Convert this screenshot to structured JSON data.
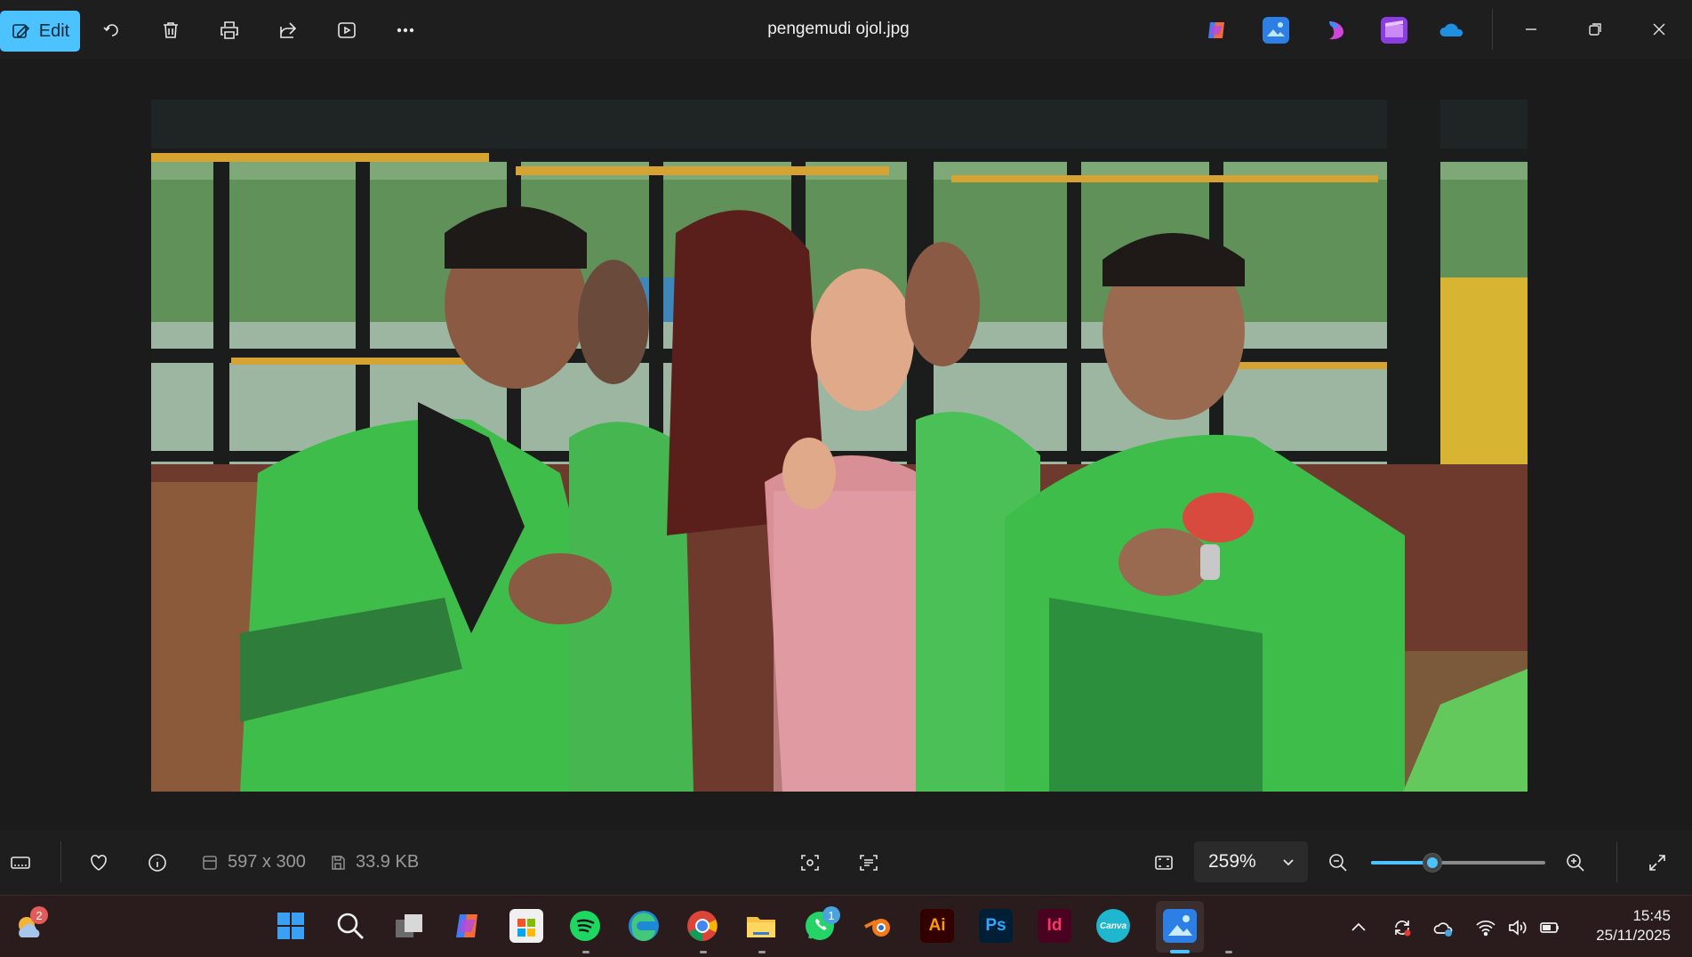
{
  "titlebar": {
    "edit_label": "Edit",
    "filename": "pengemudi ojol.jpg",
    "icons": [
      "edit-icon",
      "rotate-icon",
      "delete-icon",
      "print-icon",
      "share-icon",
      "slideshow-icon",
      "more-icon"
    ],
    "app_icons": [
      "copilot-icon",
      "photos-editor-icon",
      "designer-icon",
      "clipchamp-icon",
      "onedrive-icon"
    ],
    "window_controls": [
      "minimize-icon",
      "maximize-icon",
      "close-icon"
    ]
  },
  "photo": {
    "description_alt": "pengemudi ojol.jpg"
  },
  "bottombar": {
    "dimensions": "597 x 300",
    "file_size": "33.9 KB",
    "zoom_value": "259%",
    "zoom_level": 0.35,
    "icons": [
      "filmstrip-icon",
      "favorite-icon",
      "info-icon",
      "dimensions-icon",
      "filesize-icon",
      "visual-search-icon",
      "text-scan-icon",
      "fit-to-window-icon",
      "zoom-out-icon",
      "zoom-in-icon",
      "fullscreen-icon"
    ]
  },
  "taskbar": {
    "weather_badge": "2",
    "whatsapp_badge": "1",
    "apps": [
      {
        "name": "start",
        "label": ""
      },
      {
        "name": "search",
        "label": ""
      },
      {
        "name": "task-view",
        "label": ""
      },
      {
        "name": "copilot",
        "label": ""
      },
      {
        "name": "store",
        "label": ""
      },
      {
        "name": "spotify",
        "label": ""
      },
      {
        "name": "edge",
        "label": ""
      },
      {
        "name": "chrome",
        "label": ""
      },
      {
        "name": "file-explorer",
        "label": ""
      },
      {
        "name": "whatsapp",
        "label": ""
      },
      {
        "name": "blender",
        "label": ""
      },
      {
        "name": "illustrator",
        "label": "Ai"
      },
      {
        "name": "photoshop",
        "label": "Ps"
      },
      {
        "name": "indesign",
        "label": "Id"
      },
      {
        "name": "canva",
        "label": "Canva"
      },
      {
        "name": "photos",
        "label": ""
      }
    ],
    "clock": {
      "time": "15:45",
      "date": "25/11/2025"
    }
  },
  "colors": {
    "accent": "#4cc2ff",
    "background": "#1c1b1b",
    "taskbar": "#2a1c1c"
  }
}
